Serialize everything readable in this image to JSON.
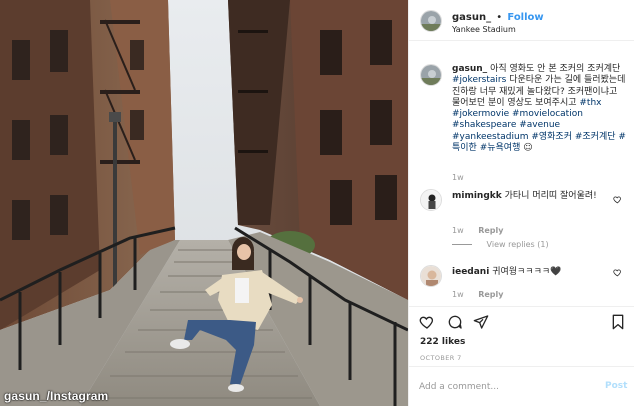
{
  "photo": {
    "credit": "gasun_/Instagram",
    "description_icon": "photo-of-woman-on-stairs"
  },
  "post": {
    "username": "gasun_",
    "separator": "•",
    "follow_label": "Follow",
    "location": "Yankee Stadium",
    "caption": {
      "username": "gasun_",
      "text_1": "아직 영화도 안 본 조커의 조커계단",
      "tag_1": "#jokerstairs",
      "text_2": "다운타운 가는 길에 들러봤는데 진하랑 너무 재밌게 놀다왔다? 조커팬이냐고 물어보던 분이 영상도 보여주시고",
      "tag_2": "#thx #jokermovie #movielocation #shakespeare #avenue #yankeestadium #영화조커 #조커계단 #특이한 #뉴욕여행",
      "emoji": "☺",
      "time": "1w"
    }
  },
  "comments": [
    {
      "username": "mimingkk",
      "text": "가타니 머리띠 잘어울려!",
      "time": "1w",
      "reply_label": "Reply"
    },
    {
      "username": "ieedani",
      "text": "귀여웡ㅋㅋㅋㅋ🖤",
      "time": "1w",
      "reply_label": "Reply"
    }
  ],
  "view_replies": "View replies (1)",
  "actions": {
    "likes": "222 likes",
    "date": "OCTOBER 7"
  },
  "comment_box": {
    "placeholder": "Add a comment...",
    "post_label": "Post"
  },
  "colors": {
    "accent": "#3897f0",
    "hashtag": "#003569",
    "meta": "#999999",
    "post_disabled": "#b2dffc"
  }
}
